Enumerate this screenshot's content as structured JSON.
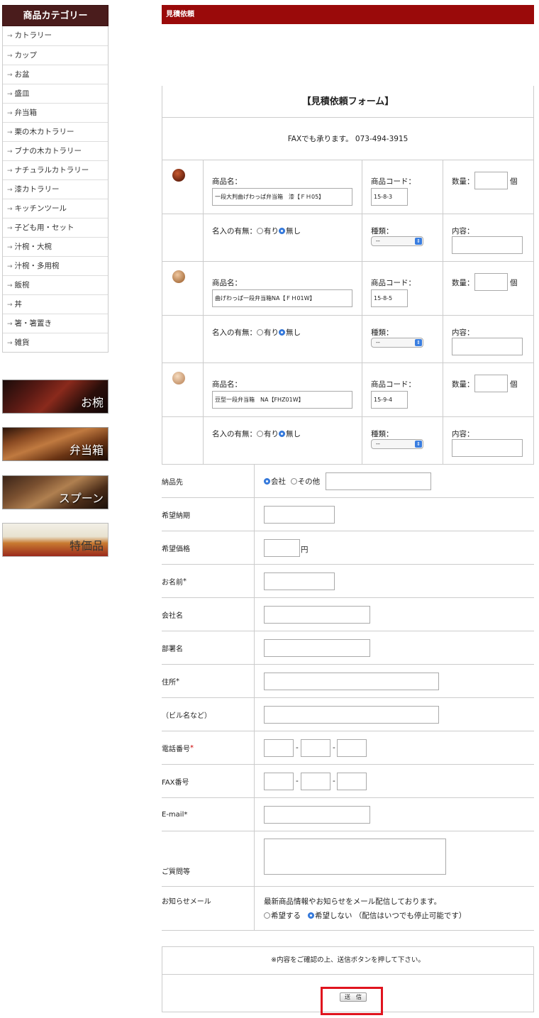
{
  "sidebar": {
    "title": "商品カテゴリー",
    "items": [
      "カトラリー",
      "カップ",
      "お盆",
      "盛皿",
      "弁当箱",
      "栗の木カトラリー",
      "ブナの木カトラリー",
      "ナチュラルカトラリー",
      "漆カトラリー",
      "キッチンツール",
      "子ども用・セット",
      "汁椀・大椀",
      "汁椀・多用椀",
      "飯椀",
      "丼",
      "箸・箸置き",
      "雑貨"
    ],
    "banners": [
      "お椀",
      "弁当箱",
      "スプーン",
      "特価品"
    ]
  },
  "header": {
    "title": "見積依頼"
  },
  "form": {
    "title": "【見積依頼フォーム】",
    "fax_note": "FAXでも承ります。 073-494-3915",
    "product_name_label": "商品名：",
    "product_code_label": "商品コード：",
    "qty_label": "数量：",
    "qty_unit": "個",
    "naire_label": "名入の有無：",
    "naire_yes": "有り",
    "naire_no": "無し",
    "kind_label": "種類：",
    "content_label": "内容：",
    "select_default": "--",
    "products": [
      {
        "name": "一段大判曲げわっぱ弁当箱　漆【ＦＨ05】",
        "code": "15-8-3"
      },
      {
        "name": "曲げわっぱ一段弁当箱NA【ＦＨ01W】",
        "code": "15-8-5"
      },
      {
        "name": "豆型一段弁当箱　NA【FHZ01W】",
        "code": "15-9-4"
      }
    ],
    "colors": {
      "header": "#9a0a0a",
      "sidebar_head": "#4a1c1c",
      "radio": "#3a7ee0",
      "highlight": "#e0141e"
    }
  },
  "fields": {
    "delivery": {
      "label": "納品先",
      "opt_company": "会社",
      "opt_other": "その他"
    },
    "deadline": {
      "label": "希望納期"
    },
    "price": {
      "label": "希望価格",
      "unit": "円"
    },
    "name": {
      "label": "お名前",
      "req": "*"
    },
    "company": {
      "label": "会社名"
    },
    "dept": {
      "label": "部署名"
    },
    "address": {
      "label": "住所",
      "req": "*"
    },
    "building": {
      "label": "（ビル名など）"
    },
    "tel": {
      "label": "電話番号",
      "req": "*",
      "sep": "-"
    },
    "fax": {
      "label": "FAX番号",
      "sep": "-"
    },
    "email": {
      "label": "E-mail",
      "req": "*"
    },
    "question": {
      "label": "ご質問等"
    },
    "newsletter": {
      "label": "お知らせメール",
      "desc": "最新商品情報やお知らせをメール配信しております。",
      "opt_yes": "希望する",
      "opt_no": "希望しない",
      "note": "（配信はいつでも停止可能です）"
    }
  },
  "confirm_note": "※内容をご確認の上、送信ボタンを押して下さい。",
  "submit_label": "送　信"
}
